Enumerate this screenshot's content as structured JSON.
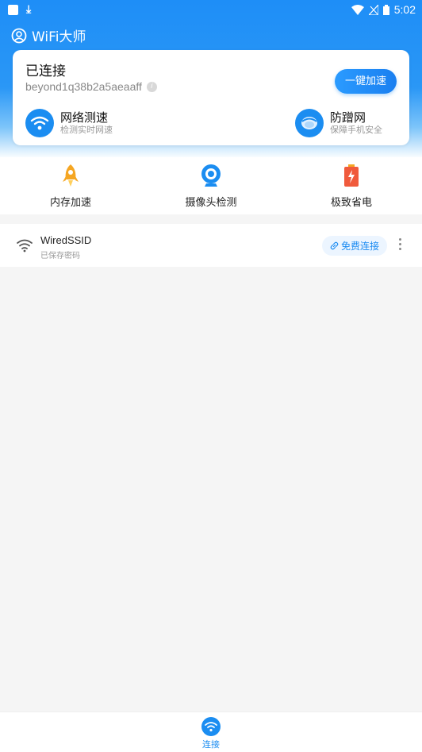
{
  "status_bar": {
    "time": "5:02"
  },
  "app": {
    "title": "WiFi大师"
  },
  "card": {
    "status": "已连接",
    "ssid": "beyond1q38b2a5aeaaff",
    "info_glyph": "i",
    "boost_label": "一键加速",
    "features": [
      {
        "title": "网络测速",
        "subtitle": "检测实时网速",
        "icon": "wifi-speed-icon"
      },
      {
        "title": "防蹭网",
        "subtitle": "保障手机安全",
        "icon": "shield-icon"
      }
    ]
  },
  "tools": [
    {
      "label": "内存加速",
      "icon": "rocket-icon"
    },
    {
      "label": "摄像头检测",
      "icon": "camera-icon"
    },
    {
      "label": "极致省电",
      "icon": "battery-icon"
    }
  ],
  "wifi_list": [
    {
      "name": "WiredSSID",
      "subtitle": "已保存密码",
      "action": "免费连接"
    }
  ],
  "bottom_nav": {
    "items": [
      {
        "label": "连接",
        "icon": "wifi-nav-icon"
      }
    ]
  },
  "colors": {
    "primary": "#1b8df1",
    "accent_orange": "#f5a623",
    "battery_red": "#f05a3c"
  }
}
